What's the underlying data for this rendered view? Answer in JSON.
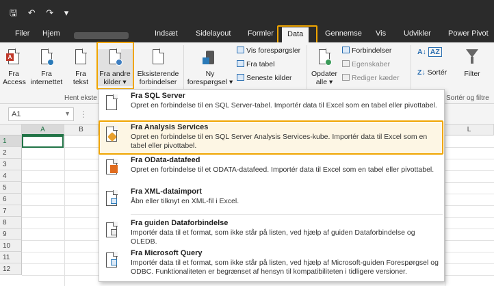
{
  "qat": {
    "save_icon": "save-icon",
    "undo_icon": "undo-icon",
    "redo_icon": "redo-icon",
    "customize": "▾"
  },
  "tabs": [
    {
      "label": "Filer"
    },
    {
      "label": "Hjem"
    },
    {
      "label": "Indsæt"
    },
    {
      "label": "Sidelayout"
    },
    {
      "label": "Formler"
    },
    {
      "label": "Data"
    },
    {
      "label": "Gennemse"
    },
    {
      "label": "Vis"
    },
    {
      "label": "Udvikler"
    },
    {
      "label": "Power Pivot"
    }
  ],
  "ribbon": {
    "access": {
      "line1": "Fra",
      "line2": "Access"
    },
    "web": {
      "line1": "Fra",
      "line2": "internettet"
    },
    "text": {
      "line1": "Fra",
      "line2": "tekst"
    },
    "other": {
      "line1": "Fra andre",
      "line2": "kilder ▾"
    },
    "existing": {
      "line1": "Eksisterende",
      "line2": "forbindelser"
    },
    "newquery": {
      "line1": "Ny",
      "line2": "forespørgsel ▾"
    },
    "show_queries": "Vis forespørgsler",
    "from_table": "Fra tabel",
    "recent_sources": "Seneste kilder",
    "refresh": {
      "line1": "Opdater",
      "line2": "alle ▾"
    },
    "connections": "Forbindelser",
    "properties": "Egenskaber",
    "edit_links": "Rediger kæder",
    "sort": "Sortér",
    "filter": "Filter",
    "group_get_external": "Hent ekste",
    "group_sort_filter": "Sortér og filtre"
  },
  "namebox": {
    "value": "A1"
  },
  "columns": [
    "A",
    "B",
    "L"
  ],
  "rows": [
    "1",
    "2",
    "3",
    "4",
    "5",
    "6",
    "7",
    "8",
    "9",
    "10",
    "11",
    "12"
  ],
  "menu": {
    "items": [
      {
        "title": "Fra SQL Server",
        "desc": "Opret en forbindelse til en SQL Server-tabel. Importér data til Excel som en tabel eller pivottabel.",
        "icon": "sql-server-icon"
      },
      {
        "title": "Fra Analysis Services",
        "desc": "Opret en forbindelse til en SQL Server Analysis Services-kube. Importér data til Excel som en tabel eller pivottabel.",
        "icon": "analysis-services-cube-icon"
      },
      {
        "title": "Fra OData-datafeed",
        "desc": "Opret en forbindelse til et ODATA-datafeed. Importér data til Excel som en tabel eller pivottabel.",
        "icon": "odata-feed-icon"
      },
      {
        "title": "Fra XML-dataimport",
        "desc": "Åbn eller tilknyt en XML-fil i Excel.",
        "icon": "xml-file-icon"
      },
      {
        "title": "Fra guiden Dataforbindelse",
        "desc": "Importér data til et format, som ikke står på listen, ved hjælp af guiden Dataforbindelse og OLEDB.",
        "icon": "data-connection-wizard-icon"
      },
      {
        "title": "Fra Microsoft Query",
        "desc": "Importér data til et format, som ikke står på listen, ved hjælp af Microsoft-guiden Forespørgsel og ODBC. Funktionaliteten er begrænset af hensyn til kompatibiliteten i tidligere versioner.",
        "icon": "microsoft-query-icon"
      }
    ]
  },
  "colors": {
    "highlight": "#f0a500",
    "excel_green": "#217346",
    "titlebar": "#2b2b2b"
  }
}
